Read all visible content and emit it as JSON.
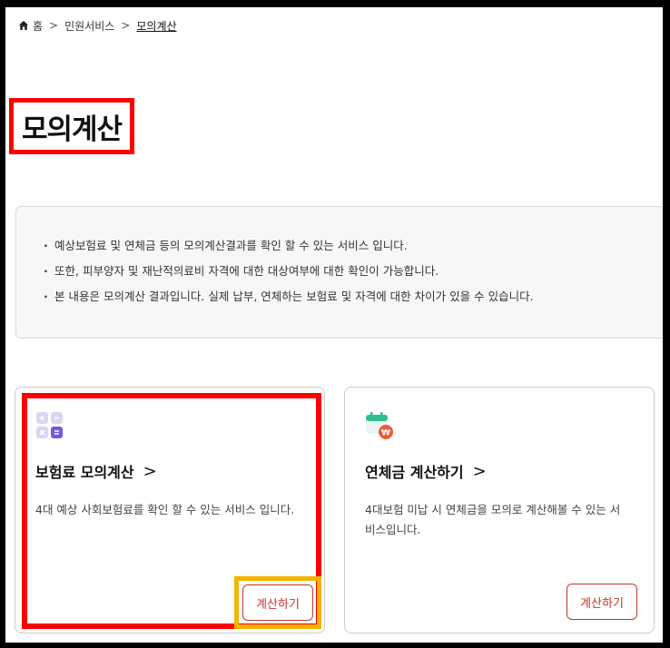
{
  "breadcrumb": {
    "home_label": "홈",
    "level1": "민원서비스",
    "current": "모의계산"
  },
  "page": {
    "title": "모의계산"
  },
  "notice": {
    "items": [
      "예상보험료 및 연체금 등의 모의계산결과를 확인 할 수 있는 서비스 입니다.",
      "또한, 피부양자 및 재난적의료비 자격에 대한 대상여부에 대한 확인이 가능합니다.",
      "본 내용은 모의계산 결과입니다. 실제 납부, 연체하는 보험료 및 자격에 대한 차이가 있을 수 있습니다."
    ]
  },
  "cards": [
    {
      "title": "보험료 모의계산",
      "description": "4대 예상 사회보험료를 확인 할 수 있는 서비스 입니다.",
      "button": "계산하기",
      "icon": "calculator-icon"
    },
    {
      "title": "연체금 계산하기",
      "description": "4대보험 미납 시 연체금을 모의로 계산해볼 수 있는 서비스입니다.",
      "button": "계산하기",
      "icon": "calendar-won-icon"
    }
  ],
  "colors": {
    "accent": "#c0392b",
    "highlight_red": "#ff0000",
    "highlight_yellow": "#f5b400"
  }
}
